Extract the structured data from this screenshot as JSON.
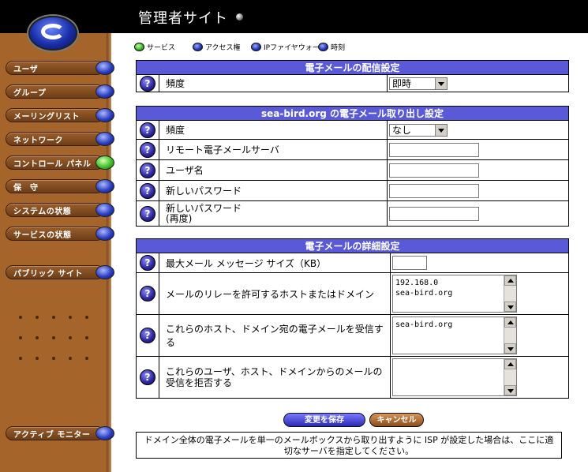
{
  "header": {
    "title": "管理者サイト"
  },
  "sidebar": {
    "items": [
      {
        "label": "ユーザ"
      },
      {
        "label": "グループ"
      },
      {
        "label": "メーリングリスト"
      },
      {
        "label": "ネットワーク"
      },
      {
        "label": "コントロール パネル"
      },
      {
        "label": "保　守"
      },
      {
        "label": "システムの状態"
      },
      {
        "label": "サービスの状態"
      },
      {
        "label": "パブリック サイト"
      },
      {
        "label": "アクティブ モニター"
      }
    ]
  },
  "tabs": [
    {
      "label": "サービス"
    },
    {
      "label": "アクセス権"
    },
    {
      "label": "IPファイヤウォール"
    },
    {
      "label": "時刻"
    }
  ],
  "delivery": {
    "header": "電子メールの配信設定",
    "frequency_label": "頻度",
    "frequency_value": "即時"
  },
  "retrieval": {
    "header": "sea-bird.org の電子メール取り出し設定",
    "frequency_label": "頻度",
    "frequency_value": "なし",
    "server_label": "リモート電子メールサーバ",
    "username_label": "ユーザ名",
    "password_label": "新しいパスワード",
    "password_confirm_label": "新しいパスワード\n(再度)"
  },
  "advanced": {
    "header": "電子メールの詳細設定",
    "max_size_label": "最大メール メッセージ サイズ（KB）",
    "max_size_value": "",
    "relay_label": "メールのリレーを許可するホストまたはドメイン",
    "relay_value": "192.168.0\nsea-bird.org",
    "receive_label": "これらのホスト、ドメイン宛の電子メールを受信する",
    "receive_value": "sea-bird.org",
    "reject_label": "これらのユーザ、ホスト、ドメインからのメールの受信を拒否する",
    "reject_value": ""
  },
  "actions": {
    "save_label": "変更を保存",
    "cancel_label": "キャンセル"
  },
  "hint": "ドメイン全体の電子メールを単一のメールボックスから取り出すように ISP が設定した場合は、ここに適切なサーバを指定してください。",
  "colors": {
    "section_header": "#5a5ad8",
    "sidebar": "#a5652a",
    "header": "#000000"
  }
}
